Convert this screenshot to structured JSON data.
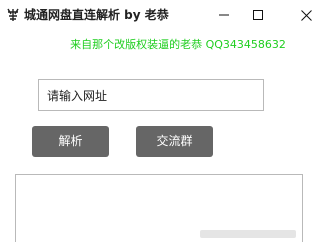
{
  "window": {
    "title": "城通网盘直连解析 by 老恭",
    "app_icon": "logo-icon",
    "controls": [
      "minimize-icon",
      "maximize-icon",
      "close-icon"
    ]
  },
  "banner": {
    "text": "来自那个改版权装逼的老恭 QQ343458632",
    "color": "#1fce1f"
  },
  "url_input": {
    "value": "请输入网址"
  },
  "buttons": {
    "parse_label": "解析",
    "group_label": "交流群",
    "background": "#666666"
  },
  "output": {
    "value": ""
  }
}
